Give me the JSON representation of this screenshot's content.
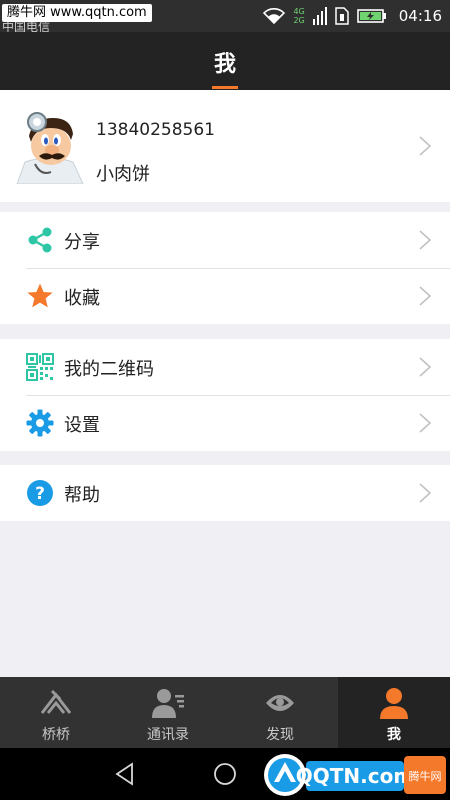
{
  "status_bar": {
    "watermark": "腾牛网 www.qqtn.com",
    "network_4g": "4G",
    "network_2g": "2G",
    "time": "04:16"
  },
  "header": {
    "title": "我"
  },
  "profile": {
    "phone": "13840258561",
    "nickname": "小肉饼",
    "avatar_icon": "mario-doctor-avatar"
  },
  "menu_groups": [
    [
      {
        "label": "分享",
        "icon": "share-icon",
        "color": "#2fc6a6"
      },
      {
        "label": "收藏",
        "icon": "star-icon",
        "color": "#f5792a"
      }
    ],
    [
      {
        "label": "我的二维码",
        "icon": "qr-code-icon",
        "color": "#2fc6a6"
      },
      {
        "label": "设置",
        "icon": "gear-icon",
        "color": "#1a9be6"
      }
    ],
    [
      {
        "label": "帮助",
        "icon": "help-icon",
        "color": "#1a9be6"
      }
    ]
  ],
  "tabs": [
    {
      "label": "桥桥",
      "icon": "bridge-icon",
      "active": false
    },
    {
      "label": "通讯录",
      "icon": "contacts-icon",
      "active": false
    },
    {
      "label": "发现",
      "icon": "discover-eye-icon",
      "active": false
    },
    {
      "label": "我",
      "icon": "person-icon",
      "active": true
    }
  ],
  "watermark_logo": {
    "text": "QQTN.com",
    "badge": "腾牛网"
  },
  "colors": {
    "accent": "#f5792a",
    "header_bg": "#232323",
    "teal": "#2fc6a6",
    "blue": "#1a9be6"
  }
}
